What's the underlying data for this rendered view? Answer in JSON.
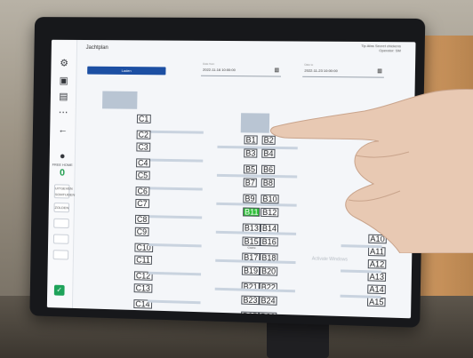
{
  "app": {
    "title": "Jachtplan",
    "header_right_line1": "Tip Afas Secret chickens",
    "header_right_line2": "Operator: SM",
    "tab_label": "Laden",
    "date_from": {
      "label": "Date from",
      "value": "2022-11-16 10:00:00"
    },
    "date_to": {
      "label": "Date to",
      "value": "2022-11-23 10:00:00"
    }
  },
  "rail": {
    "free_label": "FREE HOME",
    "free_count": "0",
    "box1": "UITGEVEN SOMTIJDEN",
    "box2": "ZOLDEN"
  },
  "stalls_left": [
    "C1",
    "C2",
    "C3",
    "C4",
    "C5",
    "C6",
    "C7",
    "C8",
    "C9",
    "C10",
    "C11",
    "C12",
    "C13",
    "C14",
    "C15"
  ],
  "stalls_middle": [
    [
      "B1",
      "B2"
    ],
    [
      "B3",
      "B4"
    ],
    [
      "B5",
      "B6"
    ],
    [
      "B7",
      "B8"
    ],
    [
      "B9",
      "B10"
    ],
    [
      "B11",
      "B12"
    ],
    [
      "B13",
      "B14"
    ],
    [
      "B15",
      "B16"
    ],
    [
      "B17",
      "B18"
    ],
    [
      "B19",
      "B20"
    ],
    [
      "B21",
      "B22"
    ],
    [
      "B23",
      "B24"
    ],
    [
      "B25",
      "B26"
    ]
  ],
  "stalls_right": [
    "A10",
    "A11",
    "A12",
    "A13",
    "A14",
    "A15"
  ],
  "active_stall": "B11",
  "small_label": "Gearte",
  "watermark": "Activate Windows",
  "colors": {
    "accent": "#1c4fa3",
    "active": "#2fbf3a",
    "count": "#1f9d4d"
  }
}
